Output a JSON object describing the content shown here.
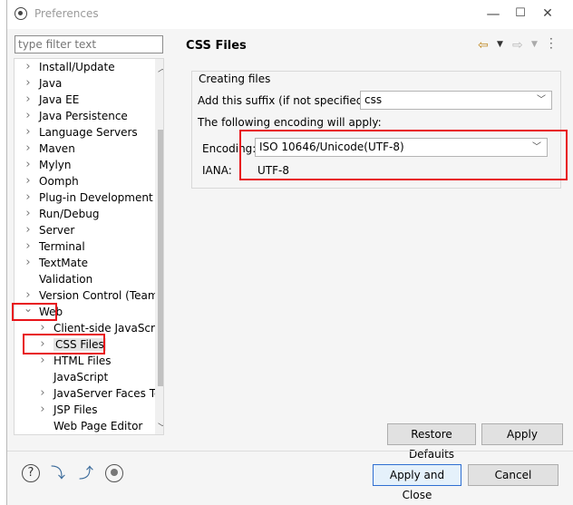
{
  "window": {
    "title": "Preferences",
    "minimize_glyph": "—",
    "maximize_glyph": "☐",
    "close_glyph": "✕"
  },
  "left": {
    "filter_placeholder": "type filter text",
    "tree": [
      {
        "label": "Install/Update",
        "indent": 0,
        "expand": "collapsed"
      },
      {
        "label": "Java",
        "indent": 0,
        "expand": "collapsed"
      },
      {
        "label": "Java EE",
        "indent": 0,
        "expand": "collapsed"
      },
      {
        "label": "Java Persistence",
        "indent": 0,
        "expand": "collapsed"
      },
      {
        "label": "Language Servers",
        "indent": 0,
        "expand": "collapsed"
      },
      {
        "label": "Maven",
        "indent": 0,
        "expand": "collapsed"
      },
      {
        "label": "Mylyn",
        "indent": 0,
        "expand": "collapsed"
      },
      {
        "label": "Oomph",
        "indent": 0,
        "expand": "collapsed"
      },
      {
        "label": "Plug-in Development",
        "indent": 0,
        "expand": "collapsed"
      },
      {
        "label": "Run/Debug",
        "indent": 0,
        "expand": "collapsed"
      },
      {
        "label": "Server",
        "indent": 0,
        "expand": "collapsed"
      },
      {
        "label": "Terminal",
        "indent": 0,
        "expand": "collapsed"
      },
      {
        "label": "TextMate",
        "indent": 0,
        "expand": "collapsed"
      },
      {
        "label": "Validation",
        "indent": 0,
        "expand": "none"
      },
      {
        "label": "Version Control (Team)",
        "indent": 0,
        "expand": "collapsed"
      },
      {
        "label": "Web",
        "indent": 0,
        "expand": "expanded"
      },
      {
        "label": "Client-side JavaScript",
        "indent": 1,
        "expand": "collapsed"
      },
      {
        "label": "CSS Files",
        "indent": 1,
        "expand": "collapsed",
        "selected": true
      },
      {
        "label": "HTML Files",
        "indent": 1,
        "expand": "collapsed"
      },
      {
        "label": "JavaScript",
        "indent": 1,
        "expand": "none"
      },
      {
        "label": "JavaServer Faces Tools",
        "indent": 1,
        "expand": "collapsed"
      },
      {
        "label": "JSP Files",
        "indent": 1,
        "expand": "collapsed"
      },
      {
        "label": "Web Page Editor",
        "indent": 1,
        "expand": "none"
      }
    ]
  },
  "page": {
    "title": "CSS Files",
    "group_label": "Creating files",
    "suffix_label": "Add this suffix (if not specified):",
    "suffix_value": "css",
    "encoding_note": "The following encoding will apply:",
    "encoding_label": "Encoding:",
    "encoding_value": "ISO 10646/Unicode(UTF-8)",
    "iana_label": "IANA:",
    "iana_value": "UTF-8",
    "restore_defaults": "Restore Defaults",
    "apply": "Apply"
  },
  "footer": {
    "apply_and_close": "Apply and Close",
    "cancel": "Cancel"
  },
  "colors": {
    "highlight_box": "#e8141a",
    "default_button_border": "#2f6fd2"
  }
}
